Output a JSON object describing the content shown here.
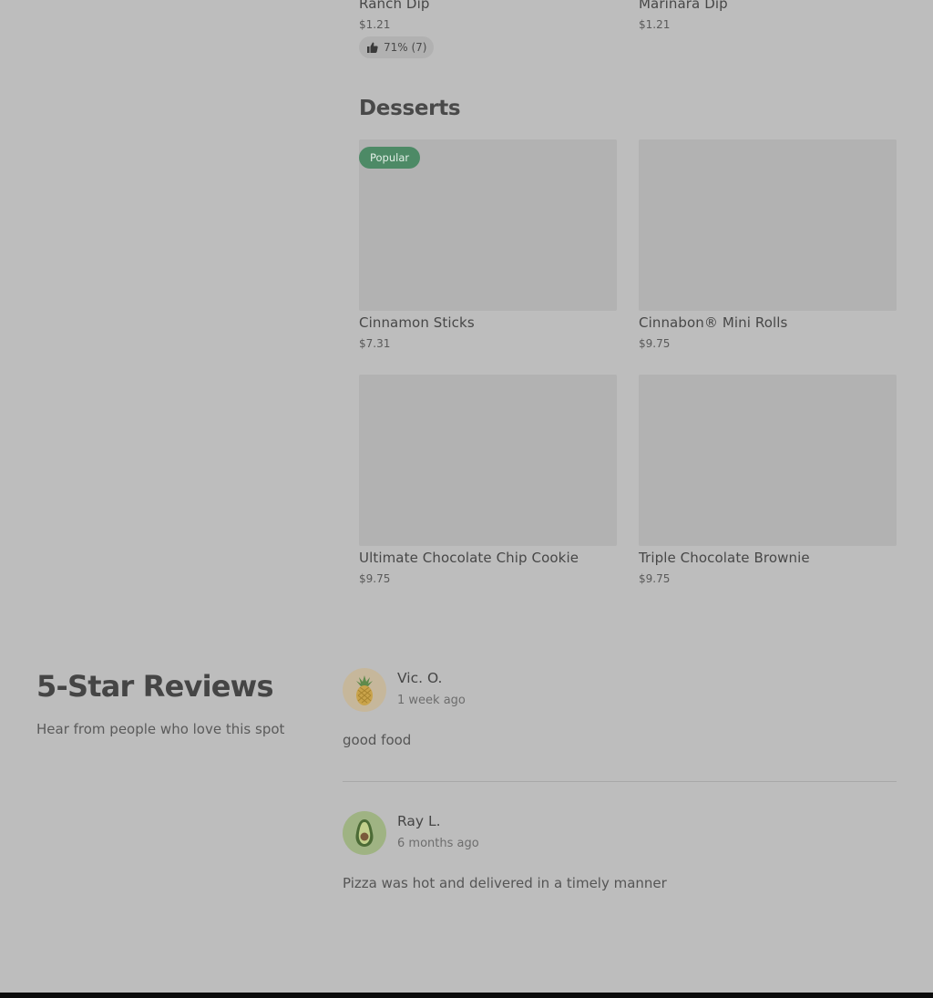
{
  "top_items": [
    {
      "name": "Ranch Dip",
      "price": "$1.21",
      "rating": "71% (7)"
    },
    {
      "name": "Marinara Dip",
      "price": "$1.21"
    }
  ],
  "desserts": {
    "title": "Desserts",
    "badge": "Popular",
    "items": [
      {
        "name": "Cinnamon Sticks",
        "price": "$7.31"
      },
      {
        "name": "Cinnabon® Mini Rolls",
        "price": "$9.75"
      },
      {
        "name": "Ultimate Chocolate Chip Cookie",
        "price": "$9.75"
      },
      {
        "name": "Triple Chocolate Brownie",
        "price": "$9.75"
      }
    ]
  },
  "reviews": {
    "title": "5-Star Reviews",
    "subtitle": "Hear from people who love this spot",
    "list": [
      {
        "name": "Vic. O.",
        "time": "1 week ago",
        "text": "good food",
        "avatar_icon": "pineapple-icon"
      },
      {
        "name": "Ray L.",
        "time": "6 months ago",
        "text": "Pizza was hot and delivered in a timely manner",
        "avatar_icon": "avocado-icon"
      }
    ]
  },
  "colors": {
    "overlay_bg": "#bdbdbd",
    "popular_badge": "#4d8a66",
    "footer": "#0c0c0c"
  }
}
